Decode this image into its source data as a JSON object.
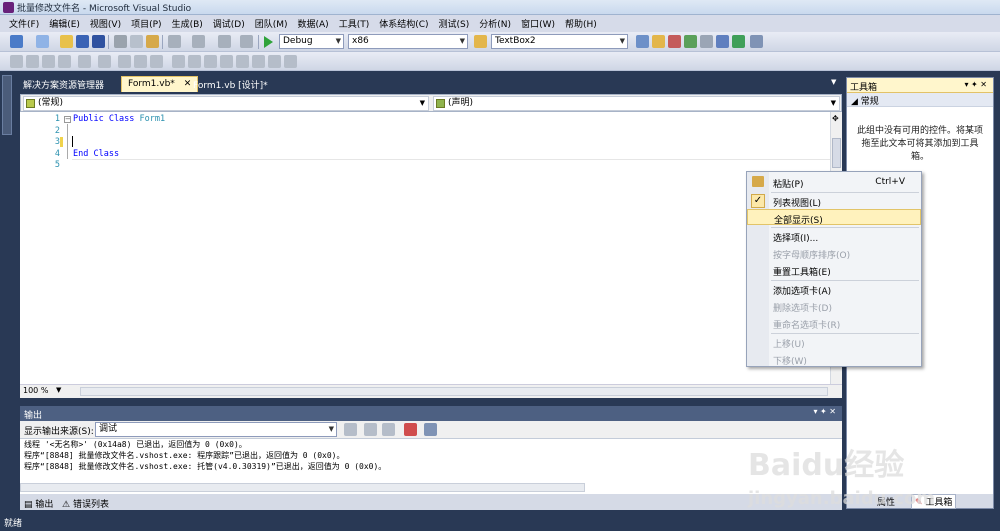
{
  "window": {
    "title": "批量修改文件名 - Microsoft Visual Studio"
  },
  "menu": [
    "文件(F)",
    "编辑(E)",
    "视图(V)",
    "项目(P)",
    "生成(B)",
    "调试(D)",
    "团队(M)",
    "数据(A)",
    "工具(T)",
    "体系结构(C)",
    "测试(S)",
    "分析(N)",
    "窗口(W)",
    "帮助(H)"
  ],
  "toolbar": {
    "config": "Debug",
    "platform": "x86",
    "find_value": "TextBox2"
  },
  "doc_tabs": [
    "解决方案资源管理器",
    "Form1.vb*",
    "Form1.vb [设计]*"
  ],
  "nav": {
    "left": "(常规)",
    "right": "(声明)"
  },
  "editor": {
    "lines": [
      "1",
      "2",
      "3",
      "4",
      "5"
    ],
    "code": {
      "line1_kw": "Public Class",
      "line1_name": "Form1",
      "line4": "End Class"
    },
    "zoom": "100 %"
  },
  "output": {
    "title": "输出",
    "source_label": "显示输出来源(S):",
    "source_value": "调试",
    "lines": [
      "线程 '<无名称>' (0x14a8) 已退出，返回值为 0 (0x0)。",
      "程序“[8848] 批量修改文件名.vshost.exe: 程序跟踪”已退出，返回值为 0 (0x0)。",
      "程序“[8848] 批量修改文件名.vshost.exe: 托管(v4.0.30319)”已退出，返回值为 0 (0x0)。"
    ],
    "tabs": [
      "输出",
      "错误列表"
    ]
  },
  "toolbox": {
    "title": "工具箱",
    "group": "常规",
    "empty_message": "此组中没有可用的控件。将某项拖至此文本可将其添加到工具箱。",
    "bottom_tabs": [
      "属性",
      "工具箱"
    ]
  },
  "context_menu": {
    "items": [
      {
        "label": "粘贴(P)",
        "shortcut": "Ctrl+V"
      },
      {
        "label": "列表视图(L)"
      },
      {
        "label": "全部显示(S)"
      },
      {
        "label": "选择项(I)..."
      },
      {
        "label": "按字母顺序排序(O)"
      },
      {
        "label": "重置工具箱(E)"
      },
      {
        "label": "添加选项卡(A)"
      },
      {
        "label": "删除选项卡(D)"
      },
      {
        "label": "重命名选项卡(R)"
      },
      {
        "label": "上移(U)"
      },
      {
        "label": "下移(W)"
      }
    ]
  },
  "status": "就绪",
  "watermark": {
    "brand": "Baidu经验",
    "url": "jingyan.baidu.com"
  }
}
